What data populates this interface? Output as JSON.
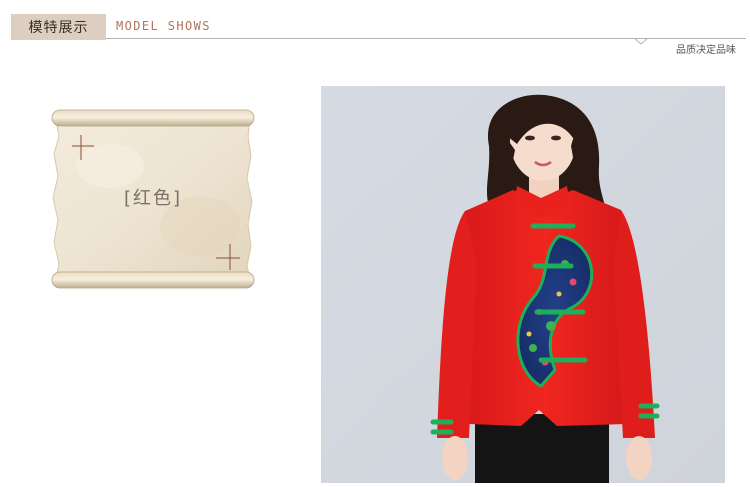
{
  "header": {
    "section_title_cn": "模特展示",
    "section_title_en": "MODEL SHOWS",
    "tagline": "品质决定品味"
  },
  "scroll": {
    "color_label": "[红色]"
  },
  "photo": {
    "subject": "model-photo",
    "jacket_color": "#e8201e",
    "accent_color": "#1fae5a",
    "background_color": "#d5d9e1"
  },
  "colors": {
    "tag_bg": "#dccfc1",
    "english_title": "#b0745a",
    "rule": "#b9b2ab",
    "parchment": "#efe6d6"
  }
}
